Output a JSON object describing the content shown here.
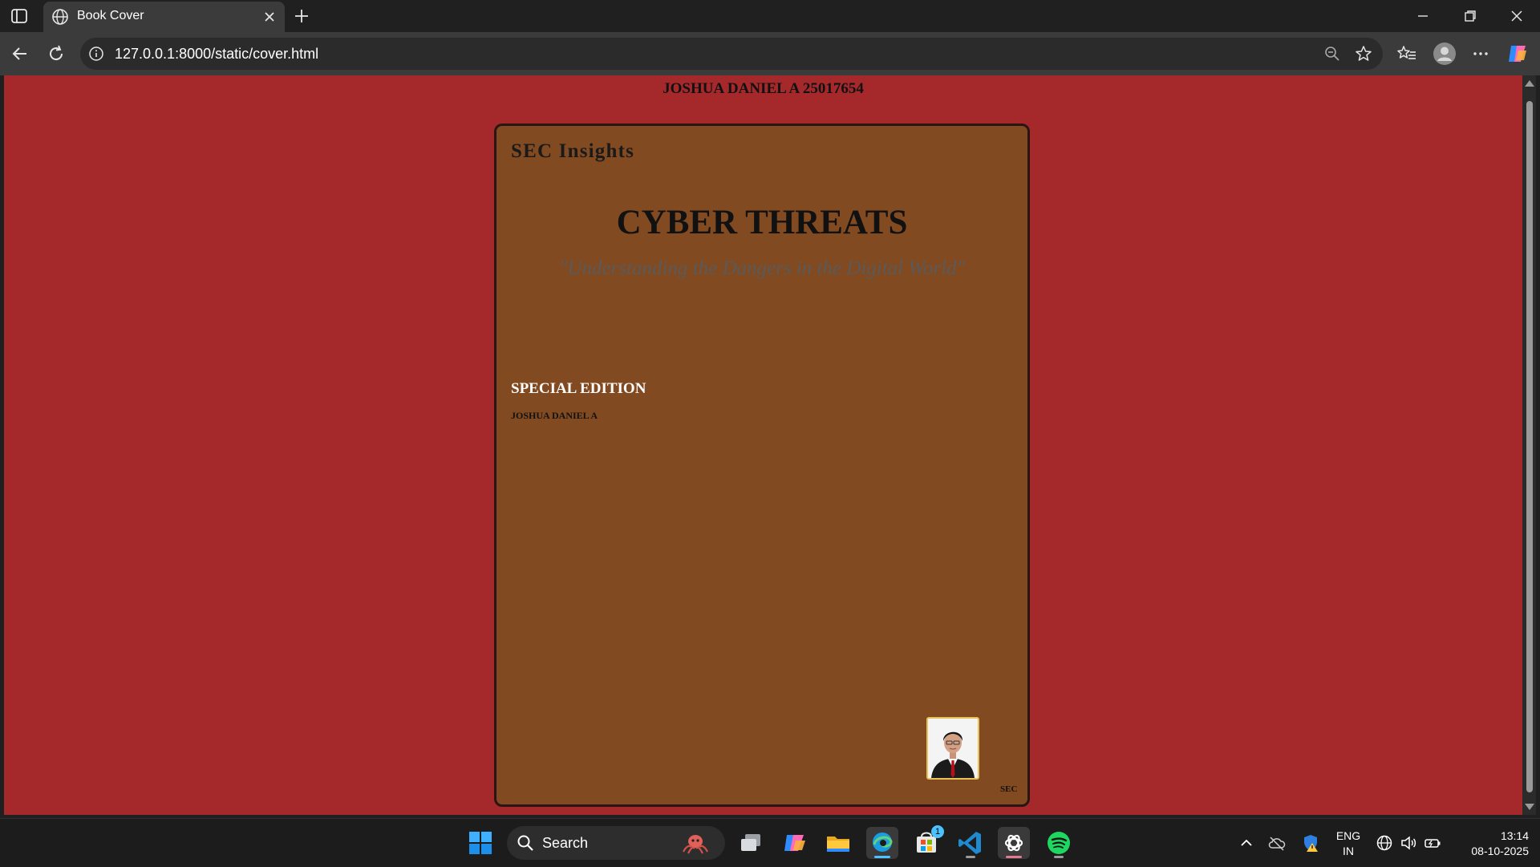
{
  "browser": {
    "tab": {
      "title": "Book Cover",
      "icon": "globe-icon"
    },
    "address_bar": {
      "url": "127.0.0.1:8000/static/cover.html"
    }
  },
  "page": {
    "header": "JOSHUA DANIEL A 25017654",
    "background_color": "#a5282b",
    "cover": {
      "background_color": "#824a21",
      "publisher": "SEC Insights",
      "title": "CYBER THREATS",
      "subtitle": "\"Understanding the Dangers in the Digital World\"",
      "edition": "SPECIAL EDITION",
      "author": "JOSHUA DANIEL A",
      "imprint": "SEC",
      "portrait": "author-portrait"
    }
  },
  "taskbar": {
    "search_label": "Search",
    "apps": [
      "windows-start",
      "search",
      "task-view",
      "copilot",
      "file-explorer",
      "edge",
      "microsoft-store",
      "vs-code",
      "chatgpt",
      "spotify"
    ],
    "store_badge": "1",
    "language": {
      "line1": "ENG",
      "line2": "IN"
    },
    "clock": {
      "time": "13:14",
      "date": "08-10-2025"
    }
  }
}
